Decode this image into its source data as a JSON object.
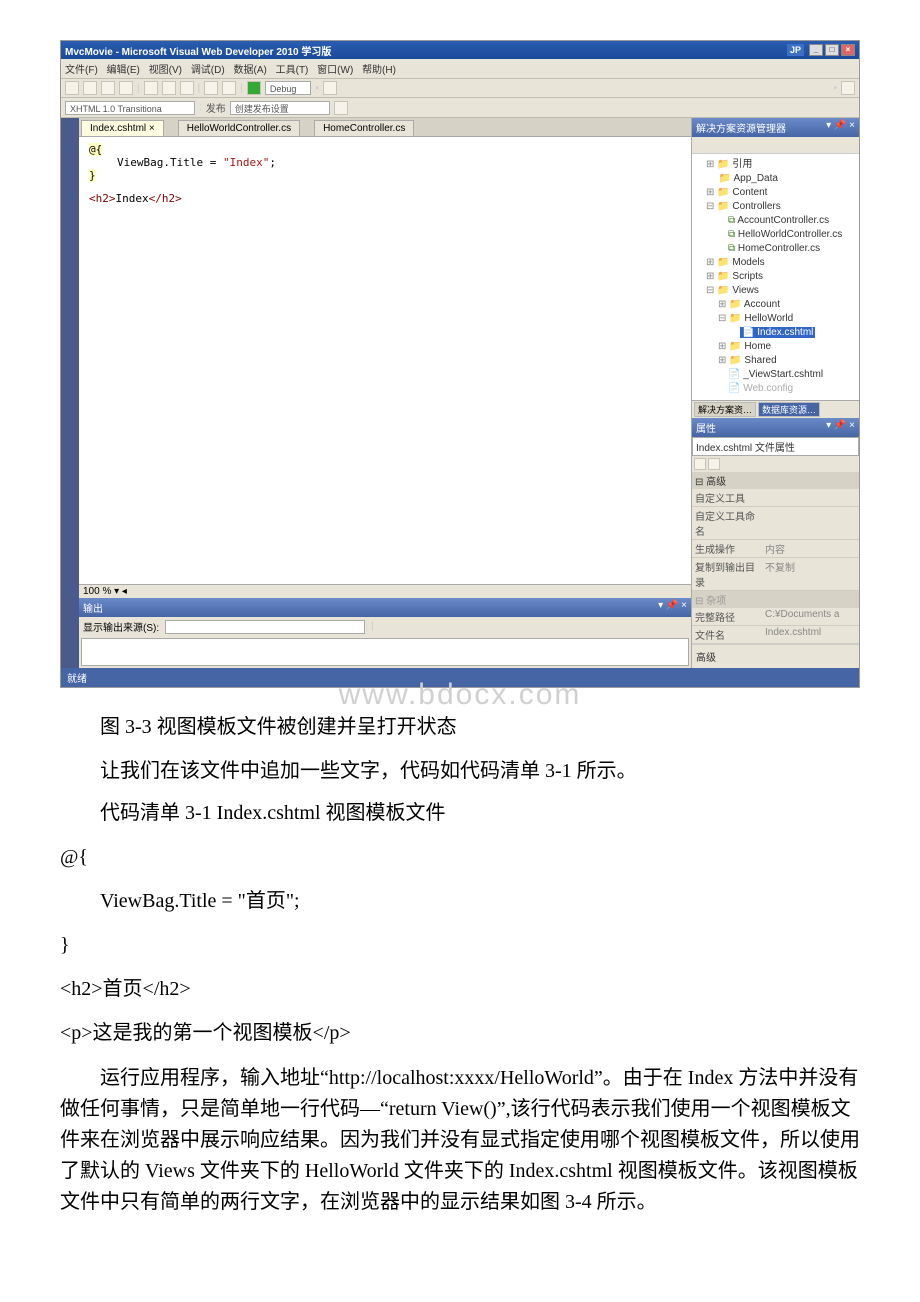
{
  "ide": {
    "title": "MvcMovie - Microsoft Visual Web Developer 2010 学习版",
    "langbar": "JP",
    "menus": [
      "文件(F)",
      "编辑(E)",
      "视图(V)",
      "调试(D)",
      "数据(A)",
      "工具(T)",
      "窗口(W)",
      "帮助(H)"
    ],
    "toolbar": {
      "config": "Debug"
    },
    "toolbar2": {
      "doctype": "XHTML 1.0 Transitiona",
      "btn1": "发布",
      "btn2": "创建发布设置"
    },
    "tabs": {
      "active": "Index.cshtml",
      "t2": "HelloWorldController.cs",
      "t3": "HomeController.cs",
      "x": "×"
    },
    "code": {
      "l1": "@{",
      "l2a": "ViewBag.Title = ",
      "l2b": "\"Index\"",
      "l2c": ";",
      "l3": "}",
      "l4a": "<h2>",
      "l4b": "Index",
      "l4c": "</h2>"
    },
    "zoom": "100 %",
    "solution": {
      "title": "解决方案资源管理器",
      "pin": "▾ 📌 ×",
      "nodes": {
        "refs": "引用",
        "appdata": "App_Data",
        "content": "Content",
        "controllers": "Controllers",
        "account_c": "AccountController.cs",
        "hello_c": "HelloWorldController.cs",
        "home_c": "HomeController.cs",
        "models": "Models",
        "scripts": "Scripts",
        "views": "Views",
        "account_v": "Account",
        "hello_v": "HelloWorld",
        "index_v": "Index.cshtml",
        "home_v": "Home",
        "shared": "Shared",
        "viewstart": "_ViewStart.cshtml",
        "webconfig": "Web.config"
      },
      "footer1": "解决方案资…",
      "footer2": "数据库资源…"
    },
    "props": {
      "title": "属性",
      "file": "Index.cshtml 文件属性",
      "group1": "高级",
      "r1k": "自定义工具",
      "r2k": "自定义工具命名",
      "r3k": "生成操作",
      "r3v": "内容",
      "r4k": "复制到输出目录",
      "r4v": "不复制",
      "group2": "杂项",
      "r5k": "完整路径",
      "r5v": "C:¥Documents a",
      "r6k": "文件名",
      "r6v": "Index.cshtml",
      "help": "高级"
    },
    "output": {
      "title": "输出",
      "label": "显示输出来源(S):"
    },
    "status": "就绪"
  },
  "article": {
    "watermark": "www.bdocx.com",
    "caption": "图 3-3 视图模板文件被创建并呈打开状态",
    "p1": "让我们在该文件中追加一些文字，代码如代码清单 3-1 所示。",
    "p2": "代码清单 3-1 Index.cshtml 视图模板文件",
    "c1": "@{",
    "c2": "    ViewBag.Title = \"首页\";",
    "c3": "}",
    "c4": "<h2>首页</h2>",
    "c5": "<p>这是我的第一个视图模板</p>",
    "body": "运行应用程序，输入地址“http://localhost:xxxx/HelloWorld”。由于在 Index 方法中并没有做任何事情，只是简单地一行代码—“return View()”,该行代码表示我们使用一个视图模板文件来在浏览器中展示响应结果。因为我们并没有显式指定使用哪个视图模板文件，所以使用了默认的 Views 文件夹下的 HelloWorld 文件夹下的 Index.cshtml 视图模板文件。该视图模板文件中只有简单的两行文字，在浏览器中的显示结果如图 3-4 所示。"
  }
}
